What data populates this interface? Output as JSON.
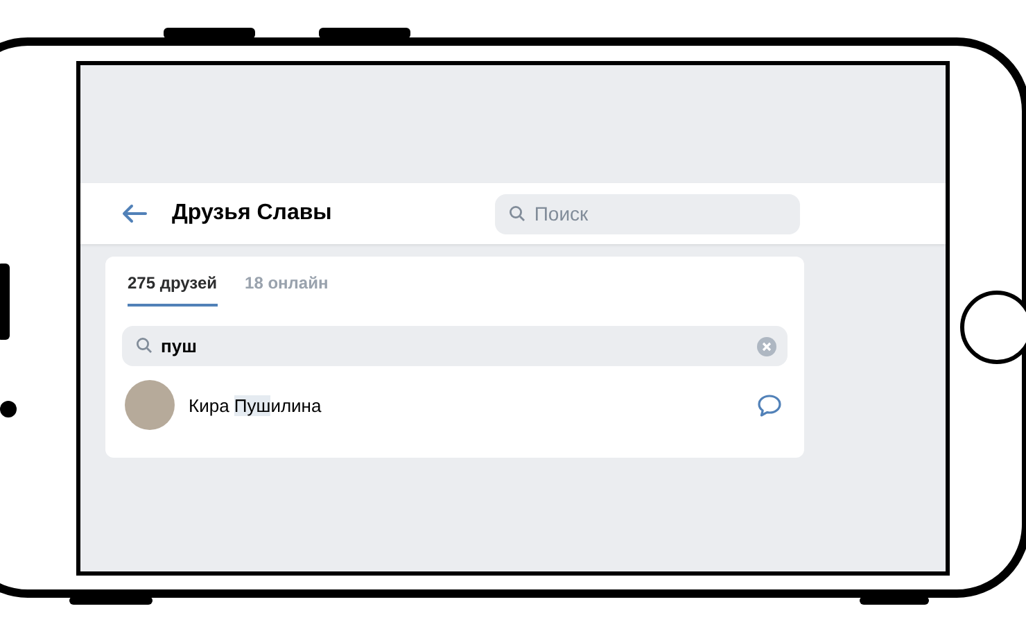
{
  "header": {
    "title": "Друзья Славы",
    "search": {
      "placeholder": "Поиск"
    }
  },
  "tabs": [
    {
      "label": "275 друзей",
      "selected": true
    },
    {
      "label": "18 онлайн",
      "selected": false
    }
  ],
  "filter": {
    "value": "пуш"
  },
  "results": [
    {
      "name_prefix": "Кира ",
      "name_match": "Пуш",
      "name_suffix": "илина"
    }
  ]
}
